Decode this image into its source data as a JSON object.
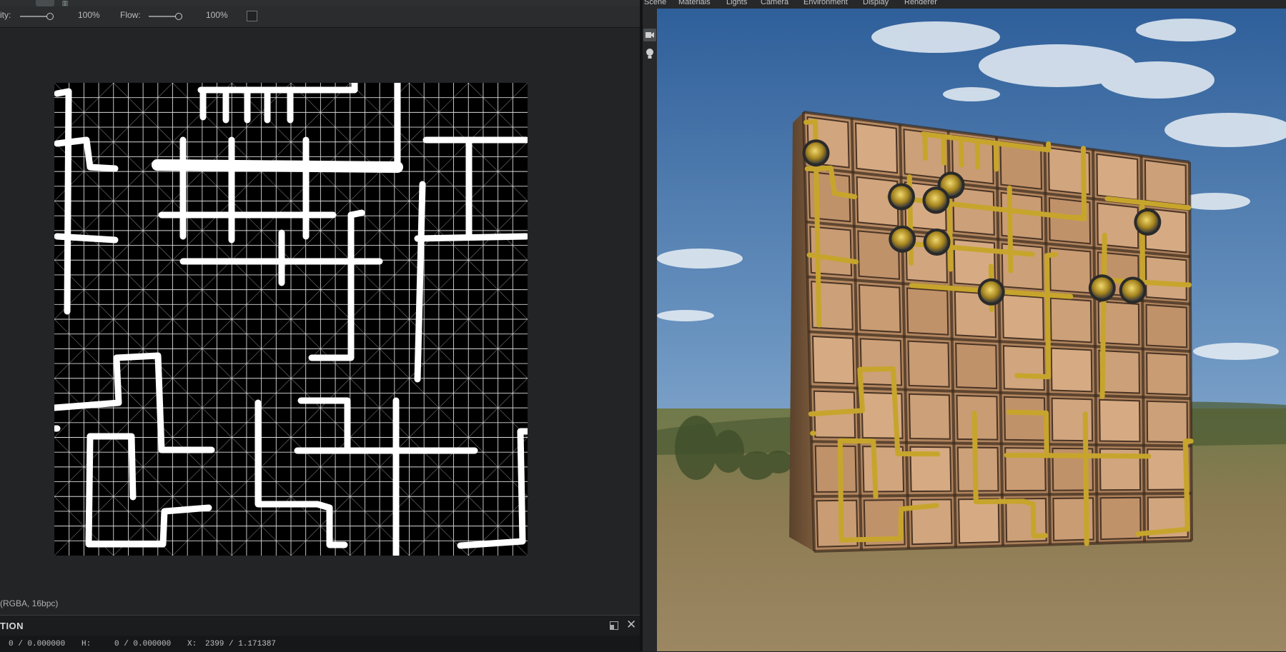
{
  "toolbar": {
    "opacity_label": "ity:",
    "opacity_value": 100,
    "opacity_text": "100%",
    "flow_label": "Flow:",
    "flow_value": 100,
    "flow_text": "100%"
  },
  "canvas": {
    "format_label": "(RGBA, 16bpc)"
  },
  "bottom_panel": {
    "title": "TION",
    "readout": {
      "w_value": "0 / 0.000000",
      "h_label": "H:",
      "h_value": "0 / 0.000000",
      "x_label": "X:",
      "x_value": "2399 / 1.171387"
    }
  },
  "viewport": {
    "menu": [
      "Scene",
      "Materials",
      "Lights",
      "Camera",
      "Environment",
      "Display",
      "Renderer"
    ]
  },
  "icons": {
    "camera": "camera-icon",
    "light": "light-bulb-icon",
    "restore": "restore-window-icon",
    "close": "close-icon"
  },
  "colors": {
    "panel_bg": "#232526",
    "toolbar_bg": "#2a2c2e",
    "texture_bg": "#000000",
    "texture_stroke": "#ffffff",
    "tile_color": "#c89a72",
    "pipe_color": "#c7a52c",
    "sky_top": "#2f5f9a",
    "sky_bottom": "#a7c2dc",
    "ground": "#8f7a52"
  }
}
